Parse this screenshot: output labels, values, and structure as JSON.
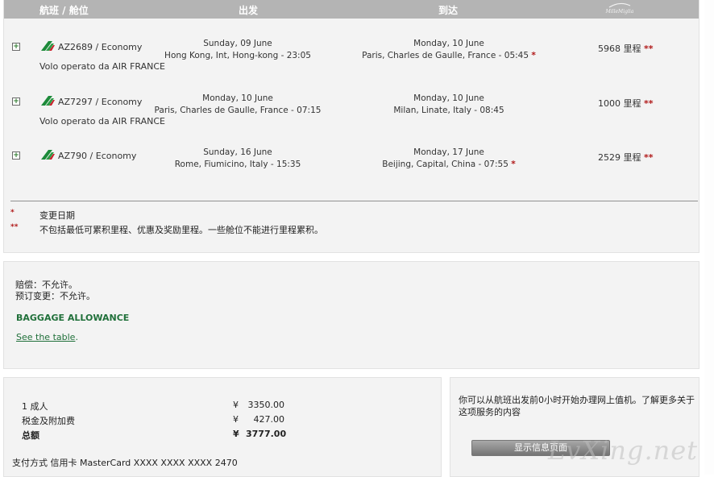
{
  "header": {
    "flight_class": "航班 / 舱位",
    "departure": "出发",
    "arrival": "到达",
    "logo_text": "MilleMiglia"
  },
  "flights": [
    {
      "flight": "AZ2689 / Economy",
      "operated_by": "Volo operato da AIR FRANCE",
      "dep_date": "Sunday, 09 June",
      "dep_place": "Hong Kong, Int, Hong-kong - 23:05",
      "arr_date": "Monday, 10 June",
      "arr_place": "Paris, Charles de Gaulle, France - 05:45",
      "arr_mark": "*",
      "miles": "5968 里程",
      "miles_mark": "**"
    },
    {
      "flight": "AZ7297 / Economy",
      "operated_by": "Volo operato da AIR FRANCE",
      "dep_date": "Monday, 10 June",
      "dep_place": "Paris, Charles de Gaulle, France - 07:15",
      "arr_date": "Monday, 10 June",
      "arr_place": "Milan, Linate, Italy - 08:45",
      "arr_mark": "",
      "miles": "1000 里程",
      "miles_mark": "**"
    },
    {
      "flight": "AZ790 / Economy",
      "operated_by": "",
      "dep_date": "Sunday, 16 June",
      "dep_place": "Rome, Fiumicino, Italy - 15:35",
      "arr_date": "Monday, 17 June",
      "arr_place": "Beijing, Capital, China - 07:55",
      "arr_mark": "*",
      "miles": "2529 里程",
      "miles_mark": "**"
    }
  ],
  "notes": [
    {
      "mark": "*",
      "text": "变更日期"
    },
    {
      "mark": "**",
      "text": "不包括最低可累积里程、优惠及奖励里程。一些舱位不能进行里程累积。"
    }
  ],
  "rules": {
    "refund": "赔偿：不允许。",
    "change": "预订变更：不允许。",
    "baggage_title": "BAGGAGE ALLOWANCE",
    "baggage_link": "See the table",
    "baggage_link_suffix": "."
  },
  "price": {
    "adults_label": "1 成人",
    "adults_currency": "¥",
    "adults_value": "3350.00",
    "tax_label": "税金及附加费",
    "tax_currency": "¥",
    "tax_value": "427.00",
    "total_label": "总额",
    "total_currency": "¥",
    "total_value": "3777.00",
    "payment": "支付方式 信用卡 MasterCard XXXX XXXX XXXX 2470"
  },
  "checkin": {
    "text": "你可以从航班出发前0小时开始办理网上值机。了解更多关于这项服务的内容",
    "button": "显示信息页面"
  },
  "watermark": "LvXing.net",
  "colors": {
    "header_bg": "#b4b4b4",
    "panel_bg": "#f3f3f3",
    "accent_green": "#20703a",
    "mark_red": "#b01818"
  }
}
